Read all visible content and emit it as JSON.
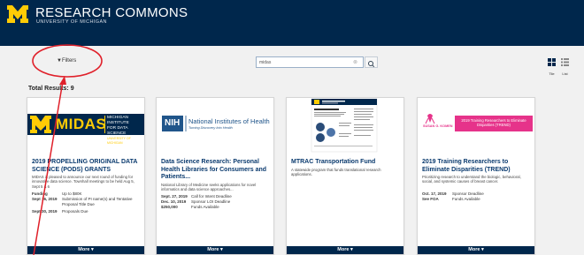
{
  "header": {
    "title": "RESEARCH COMMONS",
    "subtitle": "UNIVERSITY OF MICHIGAN"
  },
  "toolbar": {
    "filters_label": "Filters",
    "search_value": "midas",
    "tile_label": "Tile",
    "list_label": "List"
  },
  "results": {
    "total_label": "Total Results: 9"
  },
  "cards": [
    {
      "logo_text": "MIDAS",
      "logo_sub1": "MICHIGAN INSTITUTE",
      "logo_sub2": "FOR DATA SCIENCE",
      "logo_sub3": "UNIVERSITY OF MICHIGAN",
      "title": "2019 PROPELLING ORIGINAL DATA SCIENCE (PODS) GRANTS",
      "desc": "MIDAS is pleased to announce our next round of funding for innovative data science. Townhall meetings to be held Aug 5, Sept 5 & 6",
      "rows": [
        {
          "k": "Funding",
          "v": "Up to $80K"
        },
        {
          "k": "Sept 16, 2019",
          "v": "Submission of PI name(s) and Tentative Proposal Title Due"
        },
        {
          "k": "Sept 30, 2019",
          "v": "Proposals Due"
        }
      ],
      "more": "More"
    },
    {
      "logo_text": "NIH",
      "logo_sub1": "National Institutes of Health",
      "logo_sub2": "Turning Discovery Into Health",
      "title": "Data Science Research: Personal Health Libraries for Consumers and Patients...",
      "desc": "National Library of Medicine seeks applications for novel informatics and data science approaches...",
      "rows": [
        {
          "k": "Sept. 27, 2019",
          "v": "Call for Intent Deadline"
        },
        {
          "k": "Dec. 10, 2019",
          "v": "Sponsor LOI Deadline"
        },
        {
          "k": "$250,000",
          "v": "Funds Available"
        }
      ],
      "more": "More"
    },
    {
      "logo_text": "MTRAC Transportation Fund",
      "title": "MTRAC Transportation Fund",
      "desc": "A statewide program that funds translational research applications.",
      "rows": [],
      "more": "More"
    },
    {
      "logo_text": "2019 Training Researchers to Eliminate Disparities (TREND)",
      "logo_sub1": "SUSAN G. KOMEN",
      "title": "2019 Training Researchers to Eliminate Disparities (TREND)",
      "desc": "Prioritizing research to understand the biologic, behavioral, social, and systemic causes of breast cancer.",
      "rows": [
        {
          "k": "Oct. 17, 2019",
          "v": "Sponsor Deadline"
        },
        {
          "k": "See FOA",
          "v": "Funds Available"
        }
      ],
      "more": "More"
    }
  ],
  "colors": {
    "header": "#00274c",
    "maize": "#ffcb05",
    "link": "#0a3a6e",
    "annotation": "#e0202a",
    "komen_pink": "#e6338a"
  }
}
